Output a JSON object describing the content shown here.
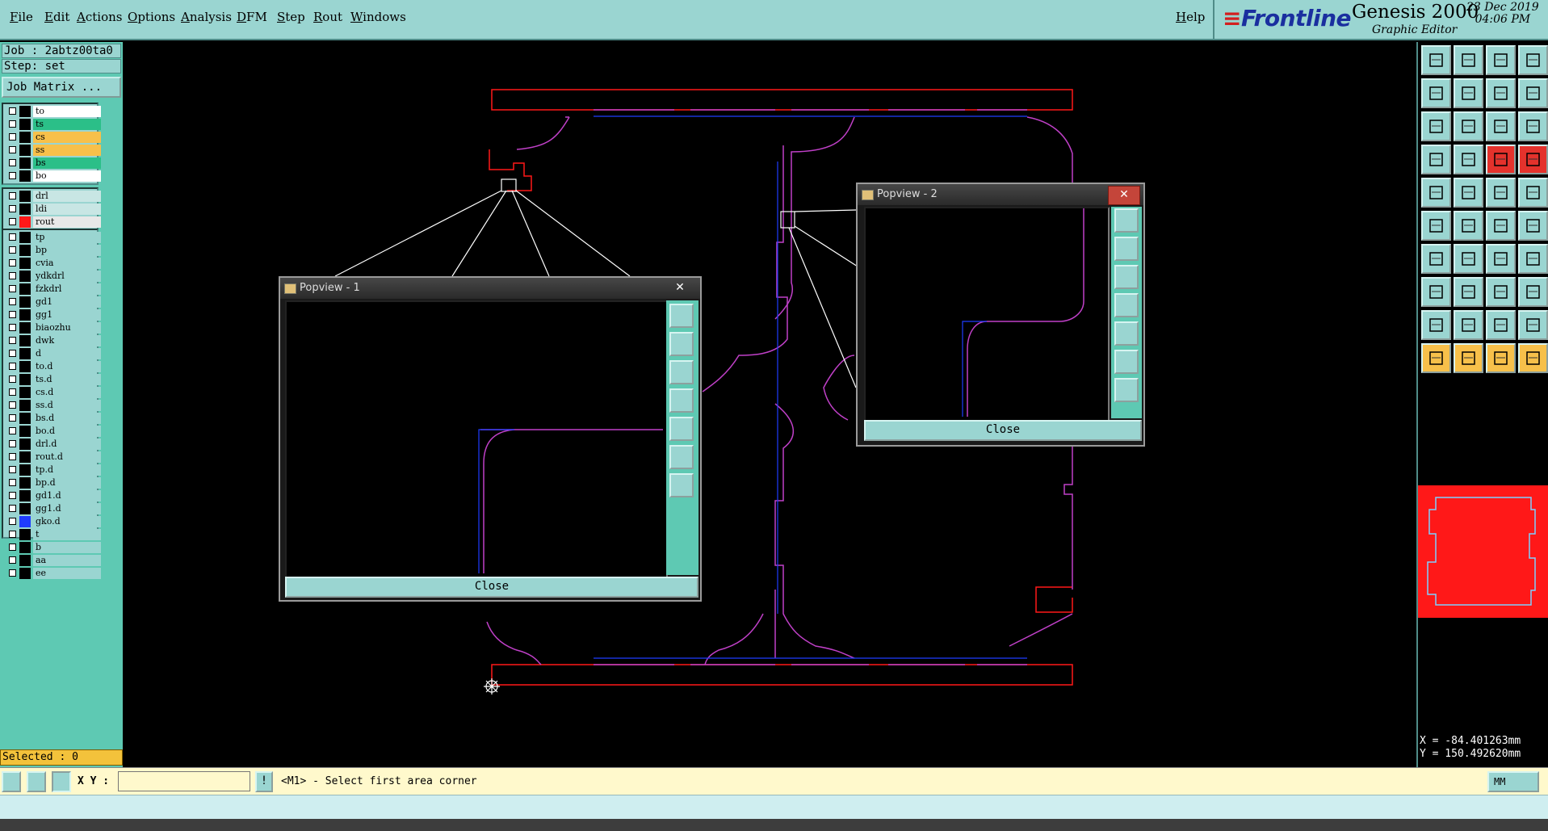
{
  "menubar": {
    "items": [
      "File",
      "Edit",
      "Actions",
      "Options",
      "Analysis",
      "DFM",
      "Step",
      "Rout",
      "Windows"
    ],
    "help": "Help"
  },
  "brand": {
    "logo": "Frontline",
    "product": "Genesis 2000",
    "subtitle": "Graphic Editor",
    "date": "23 Dec 2019",
    "time": "04:06 PM"
  },
  "job": {
    "job_line": "Job : 2abtz00ta0",
    "step_line": "Step: set",
    "matrix_button": "Job Matrix ..."
  },
  "layers": {
    "group1": [
      {
        "name": "to",
        "color": "#ffffff"
      },
      {
        "name": "ts",
        "color": "#2bbf88"
      },
      {
        "name": "cs",
        "color": "#f7c04a"
      },
      {
        "name": "ss",
        "color": "#f7c04a"
      },
      {
        "name": "bs",
        "color": "#2bbf88"
      },
      {
        "name": "bo",
        "color": "#ffffff"
      }
    ],
    "group2": [
      {
        "name": "drl",
        "color": "#c8e6e4"
      },
      {
        "name": "ldi",
        "color": "#c8e6e4"
      },
      {
        "name": "rout",
        "color": "#e8e8e8",
        "swatch": "#ff1818",
        "active": true
      }
    ],
    "group3": [
      {
        "name": "tp"
      },
      {
        "name": "bp"
      },
      {
        "name": "cvia"
      },
      {
        "name": "ydkdrl"
      },
      {
        "name": "fzkdrl"
      },
      {
        "name": "gd1"
      },
      {
        "name": "gg1"
      },
      {
        "name": "biaozhu"
      },
      {
        "name": "dwk"
      },
      {
        "name": "d"
      },
      {
        "name": "to.d"
      },
      {
        "name": "ts.d"
      },
      {
        "name": "cs.d"
      },
      {
        "name": "ss.d"
      },
      {
        "name": "bs.d"
      },
      {
        "name": "bo.d"
      },
      {
        "name": "drl.d"
      },
      {
        "name": "rout.d"
      },
      {
        "name": "tp.d"
      },
      {
        "name": "bp.d"
      },
      {
        "name": "gd1.d"
      },
      {
        "name": "gg1.d"
      },
      {
        "name": "gko.d",
        "swatch": "#1f3cff"
      },
      {
        "name": "t"
      },
      {
        "name": "b"
      },
      {
        "name": "aa"
      },
      {
        "name": "ee"
      }
    ]
  },
  "selected_text": "Selected : 0",
  "popview1": {
    "title": "Popview - 1",
    "close_label": "Close"
  },
  "popview2": {
    "title": "Popview - 2",
    "close_label": "Close"
  },
  "coords": {
    "x": "X = -84.401263mm",
    "y": "Y = 150.492620mm"
  },
  "cmdbar": {
    "xy_label": "X Y :",
    "xy_value": "",
    "prompt": "<M1> - Select first area corner",
    "unit": "MM"
  },
  "colors": {
    "panel": "#9ad5d1",
    "panel_dark": "#5ec9b3",
    "rout": "#ff1818",
    "outline": "#c040c8",
    "accent_blue": "#1f3cff"
  },
  "toolbox_icons": [
    "zoom-home",
    "zoom-in",
    "home-icon",
    "grid-icon",
    "pan-left",
    "pan-right",
    "swap-icon",
    "snake-icon",
    "fit-icon",
    "center-icon",
    "ratio-icon",
    "help-icon",
    "measure-icon",
    "key-icon",
    "pad-red-icon",
    "pad-red-icon-2",
    "select-pad",
    "line-icon",
    "cut-icon",
    "circle-icon",
    "node-icon",
    "x-icon",
    "arc-icon",
    "arc-2-icon",
    "angle-icon",
    "slash-icon",
    "rotate-icon",
    "mirror-icon",
    "move-icon",
    "minus-icon",
    "frame-icon",
    "dots-icon",
    "triangle-red",
    "triangle-a",
    "triangle-b",
    "triangle-c",
    "pointer-icon",
    "pointer-2-icon",
    "pointer-3-icon",
    "pointer-4-icon"
  ]
}
